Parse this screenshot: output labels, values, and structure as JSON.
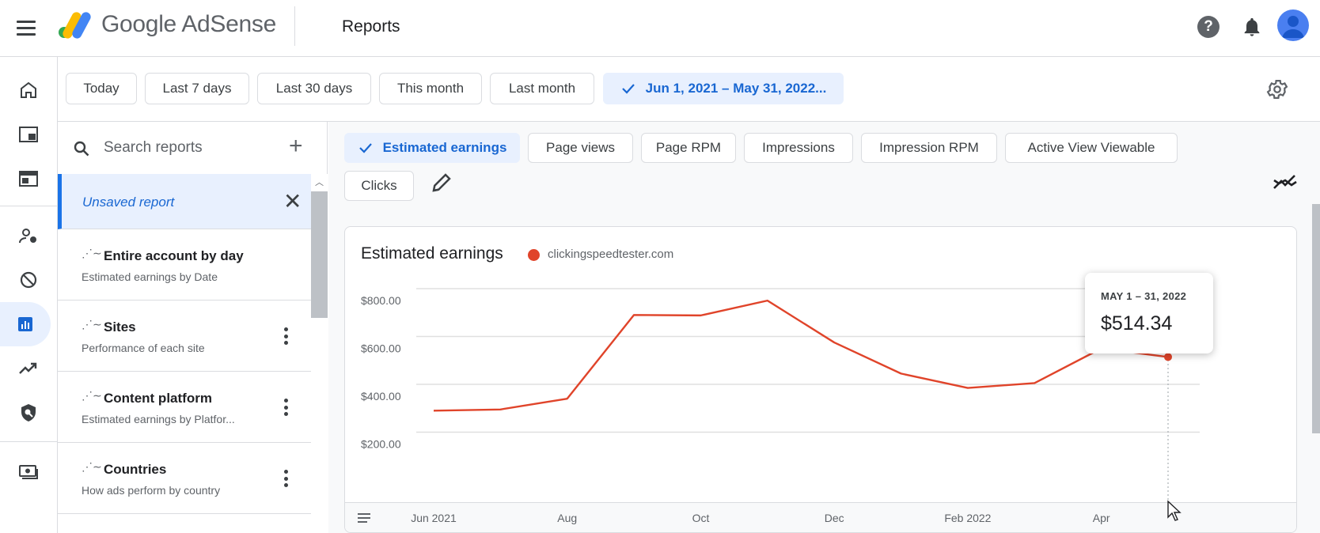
{
  "header": {
    "brand": "Google AdSense",
    "page_title": "Reports",
    "help_glyph": "?"
  },
  "nav": {
    "items": [
      "home-icon",
      "my-ads-icon",
      "sites-icon",
      "account-icon",
      "blocking-icon",
      "reports-icon",
      "optimization-icon",
      "policy-icon",
      "payments-icon"
    ],
    "active": "reports-icon"
  },
  "filters": {
    "chips": [
      "Today",
      "Last 7 days",
      "Last 30 days",
      "This month",
      "Last month"
    ],
    "selected": "Jun 1, 2021 – May 31, 2022..."
  },
  "reports": {
    "search_placeholder": "Search reports",
    "unsaved_label": "Unsaved report",
    "items": [
      {
        "title": "Entire account by day",
        "subtitle": "Estimated earnings by Date"
      },
      {
        "title": "Sites",
        "subtitle": "Performance of each site"
      },
      {
        "title": "Content platform",
        "subtitle": "Estimated earnings by Platfor..."
      },
      {
        "title": "Countries",
        "subtitle": "How ads perform by country"
      }
    ]
  },
  "metrics": {
    "selected": "Estimated earnings",
    "row1": [
      "Page views",
      "Page RPM",
      "Impressions",
      "Impression RPM",
      "Active View Viewable"
    ],
    "row2": [
      "Clicks"
    ]
  },
  "chart": {
    "title": "Estimated earnings",
    "legend": "clickingspeedtester.com",
    "tooltip_date": "MAY 1 – 31, 2022",
    "tooltip_value": "$514.34",
    "series_color": "#e0442a"
  },
  "chart_data": {
    "type": "line",
    "title": "Estimated earnings",
    "x": [
      "Jun 2021",
      "Jul 2021",
      "Aug 2021",
      "Sep 2021",
      "Oct 2021",
      "Nov 2021",
      "Dec 2021",
      "Jan 2022",
      "Feb 2022",
      "Mar 2022",
      "Apr 2022",
      "May 2022"
    ],
    "series": [
      {
        "name": "clickingspeedtester.com",
        "values": [
          290,
          295,
          340,
          690,
          688,
          750,
          575,
          445,
          385,
          405,
          550,
          514.34
        ]
      }
    ],
    "xticks": [
      "Jun 2021",
      "Aug",
      "Oct",
      "Dec",
      "Feb 2022",
      "Apr"
    ],
    "yticks": [
      "$200.00",
      "$400.00",
      "$600.00",
      "$800.00"
    ],
    "ylim": [
      200,
      800
    ],
    "grid": true,
    "legend_position": "top-left"
  }
}
